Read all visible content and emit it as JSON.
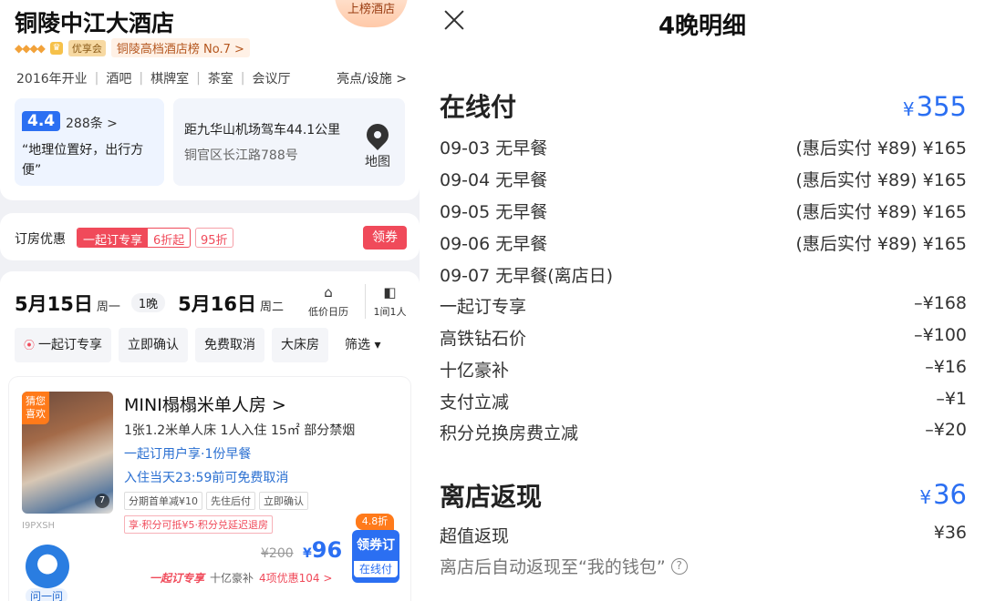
{
  "hotel": {
    "name": "铜陵中江大酒店",
    "badge": "上榜酒店",
    "diamonds": "◆◆◆◆",
    "crown_icon": "crown-icon",
    "vip": "优享会",
    "rank": "铜陵高档酒店榜 No.7 >",
    "facilities": [
      "2016年开业",
      "酒吧",
      "棋牌室",
      "茶室",
      "会议厅"
    ],
    "facilities_more": "亮点/设施 >",
    "score": "4.4",
    "review_count": "288条 >",
    "quote": "“地理位置好，出行方便”",
    "distance": "距九华山机场驾车44.1公里",
    "address": "铜官区长江路788号",
    "map_label": "地图"
  },
  "promo": {
    "title": "订房优惠",
    "tag1_a": "一起订专享",
    "tag1_b": "6折起",
    "tag2": "95折",
    "button": "领券"
  },
  "booking": {
    "checkin_date": "5月15日",
    "checkin_week": "周一",
    "nights": "1晚",
    "checkout_date": "5月16日",
    "checkout_week": "周二",
    "calendar_label": "低价日历",
    "room_people": "1间1人",
    "filters": [
      "一起订专享",
      "立即确认",
      "免费取消",
      "大床房",
      "筛选 ▾"
    ]
  },
  "room": {
    "photo_tag": "猜您喜欢",
    "photo_count": "7",
    "photo_code": "I9PXSH",
    "robot_label": "问一问",
    "name": "MINI榻榻米单人房 >",
    "spec": "1张1.2米单人床  1人入住  15㎡  部分禁烟",
    "line1": "一起订用户享·1份早餐",
    "line2": "入住当天23:59前可免费取消",
    "tags": [
      "分期首单减¥10",
      "先住后付",
      "立即确认"
    ],
    "tags2": "享·积分可抵¥5·积分兑延迟退房",
    "old_price": "¥200",
    "currency": "¥",
    "price": "96",
    "discount": "4.8折",
    "book_label": "领券订",
    "pay_label": "在线付",
    "savings_brand": "一起订专享",
    "savings_1": "十亿豪补",
    "savings_2": "4项优惠104 >"
  },
  "detail": {
    "title": "4晚明细",
    "online": {
      "title": "在线付",
      "currency": "¥",
      "amount": "355",
      "lines": [
        {
          "label": "09-03 无早餐",
          "value": "(惠后实付 ¥89) ¥165"
        },
        {
          "label": "09-04 无早餐",
          "value": "(惠后实付 ¥89) ¥165"
        },
        {
          "label": "09-05 无早餐",
          "value": "(惠后实付 ¥89) ¥165"
        },
        {
          "label": "09-06 无早餐",
          "value": "(惠后实付 ¥89) ¥165"
        },
        {
          "label": "09-07 无早餐(离店日)",
          "value": ""
        },
        {
          "label": "一起订专享",
          "value": "–¥168"
        },
        {
          "label": "高铁钻石价",
          "value": "–¥100"
        },
        {
          "label": "十亿豪补",
          "value": "–¥16"
        },
        {
          "label": "支付立减",
          "value": "–¥1"
        },
        {
          "label": "积分兑换房费立减",
          "value": "–¥20"
        }
      ]
    },
    "cashback": {
      "title": "离店返现",
      "currency": "¥",
      "amount": "36",
      "line_label": "超值返现",
      "line_value": "¥36",
      "footnote": "离店后自动返现至“我的钱包”"
    }
  },
  "colors": {
    "accent_blue": "#2b6ff2",
    "promo_red": "#f04a5a",
    "orange": "#ff7a1a"
  }
}
